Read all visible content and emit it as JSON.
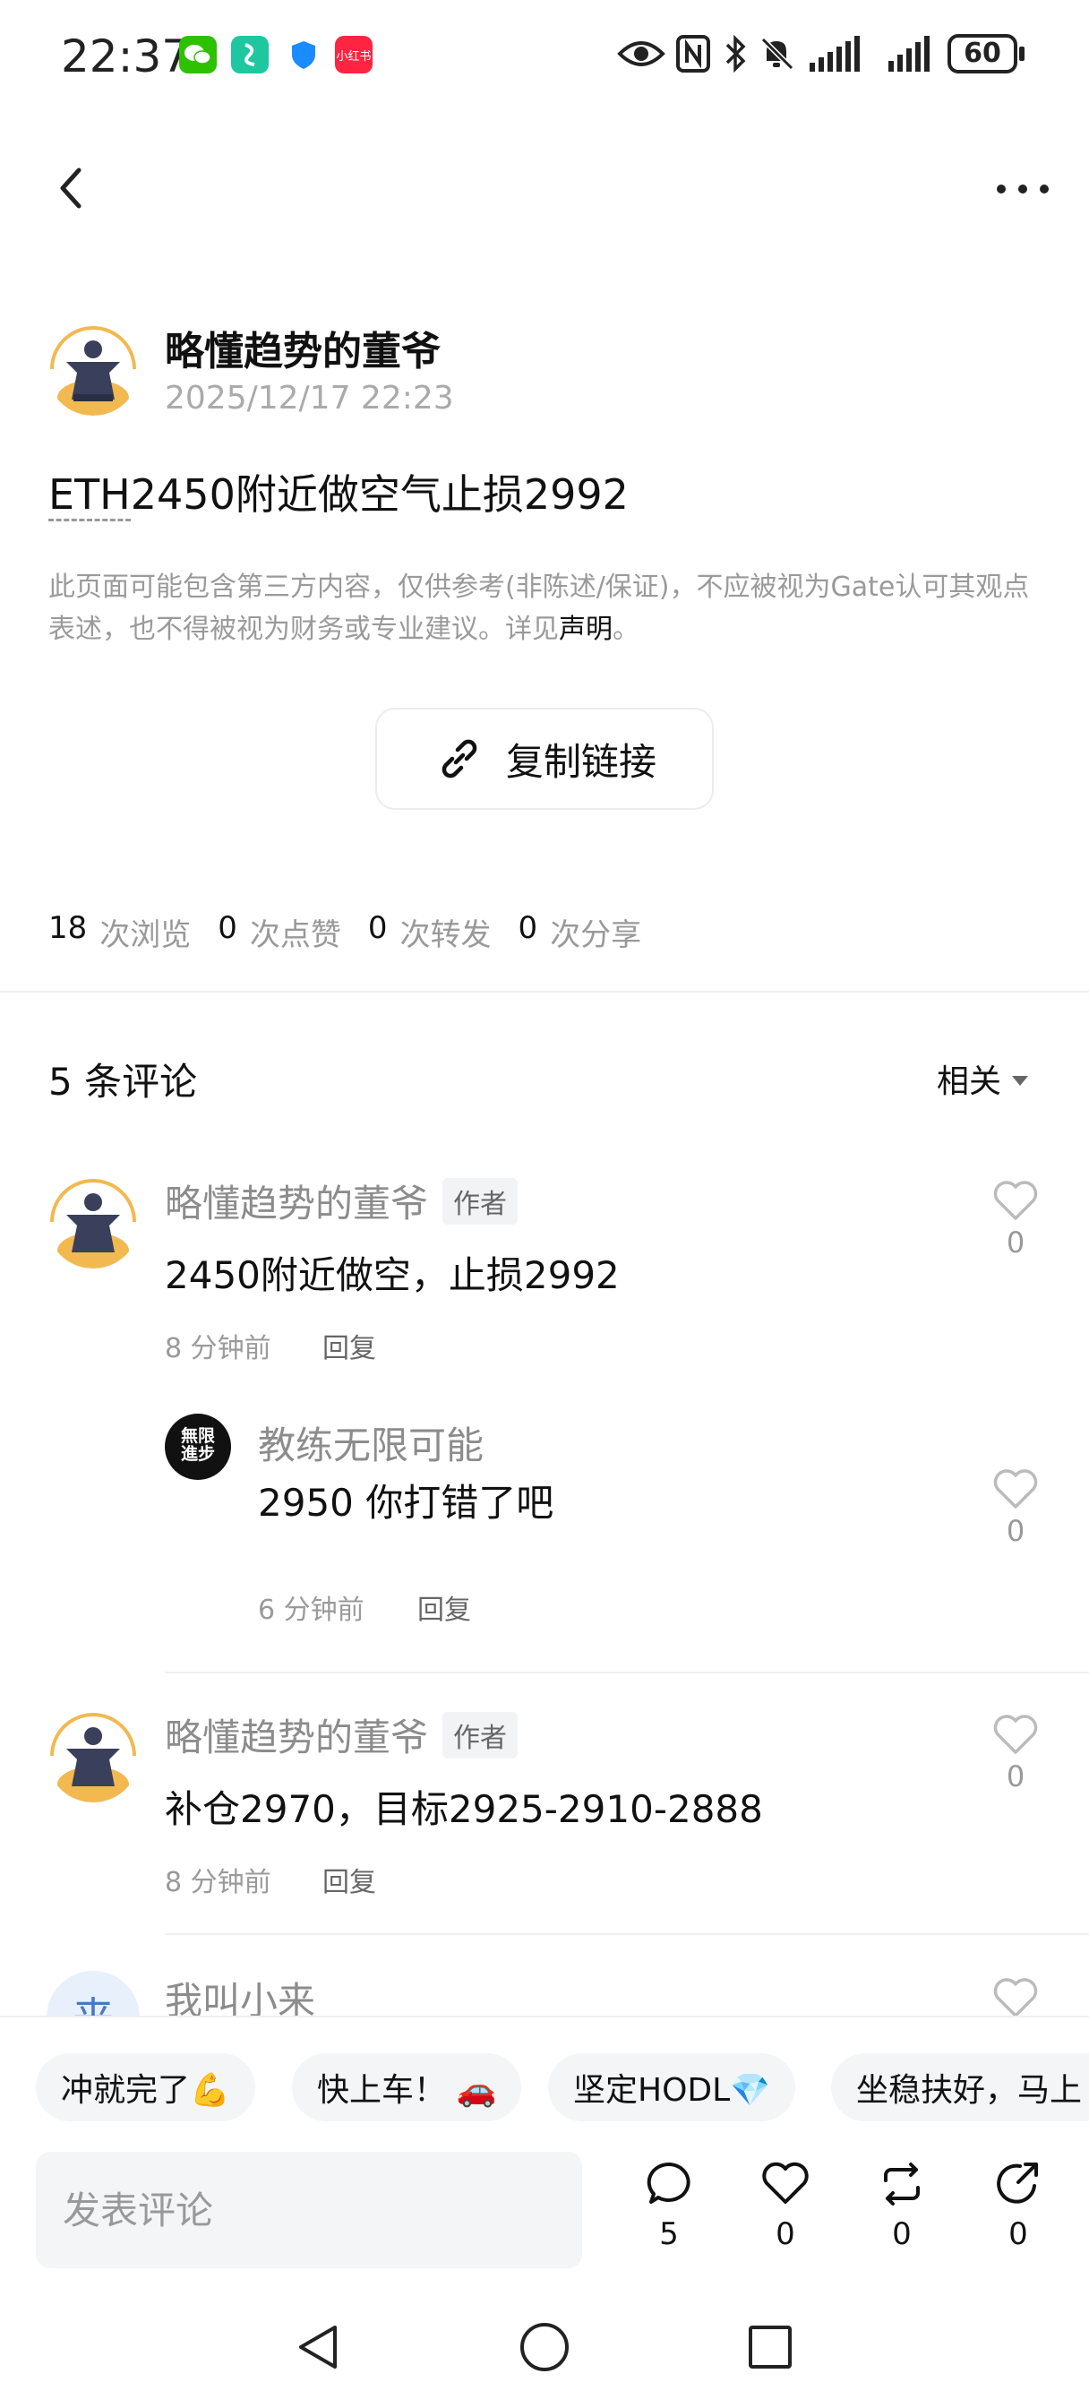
{
  "status_bar": {
    "time": "22:37",
    "battery": "60",
    "app_icons": [
      "wechat-icon",
      "green-app-icon",
      "shield-app-icon",
      "xiaohongshu-icon"
    ],
    "indicator_icons": [
      "eye-icon",
      "nfc-icon",
      "bluetooth-icon",
      "mute-bell-icon",
      "signal-1-icon",
      "signal-2-icon"
    ]
  },
  "post": {
    "author": "略懂趋势的董爷",
    "timestamp": "2025/12/17 22:23",
    "title_ticker": "ETH",
    "title_rest": "2450附近做空气止损2992",
    "disclaimer_text": "此页面可能包含第三方内容，仅供参考(非陈述/保证)，不应被视为Gate认可其观点表述，也不得被视为财务或专业建议。详见",
    "disclaimer_link": "声明",
    "disclaimer_end": "。",
    "copy_link_label": "复制链接"
  },
  "stats": {
    "views": "18",
    "views_label": "次浏览",
    "likes": "0",
    "likes_label": "次点赞",
    "reposts": "0",
    "reposts_label": "次转发",
    "shares": "0",
    "shares_label": "次分享"
  },
  "comments_header": {
    "count_label": "5 条评论",
    "sort_label": "相关"
  },
  "comments": [
    {
      "name": "略懂趋势的董爷",
      "tag": "作者",
      "text": "2450附近做空，止损2992",
      "time": "8 分钟前",
      "reply": "回复",
      "likes": "0",
      "replies": [
        {
          "name": "教练无限可能",
          "avatar_text": "無限進步",
          "text": "2950 你打错了吧",
          "time": "6 分钟前",
          "reply": "回复",
          "likes": "0"
        }
      ]
    },
    {
      "name": "略懂趋势的董爷",
      "tag": "作者",
      "text": "补仓2970，目标2925-2910-2888",
      "time": "8 分钟前",
      "reply": "回复",
      "likes": "0"
    },
    {
      "name": "我叫小来",
      "avatar_text": "来"
    }
  ],
  "quick_replies": [
    "冲就完了💪",
    "快上车！ 🚗",
    "坚定HODL💎",
    "坐稳扶好，马上"
  ],
  "bottom_bar": {
    "input_placeholder": "发表评论",
    "comment_count": "5",
    "like_count": "0",
    "repost_count": "0",
    "share_count": "0"
  },
  "colors": {
    "text_primary": "#111111",
    "text_gray": "#999999",
    "chip_bg": "#f4f5f7",
    "avatar_gold": "#f2b950"
  }
}
